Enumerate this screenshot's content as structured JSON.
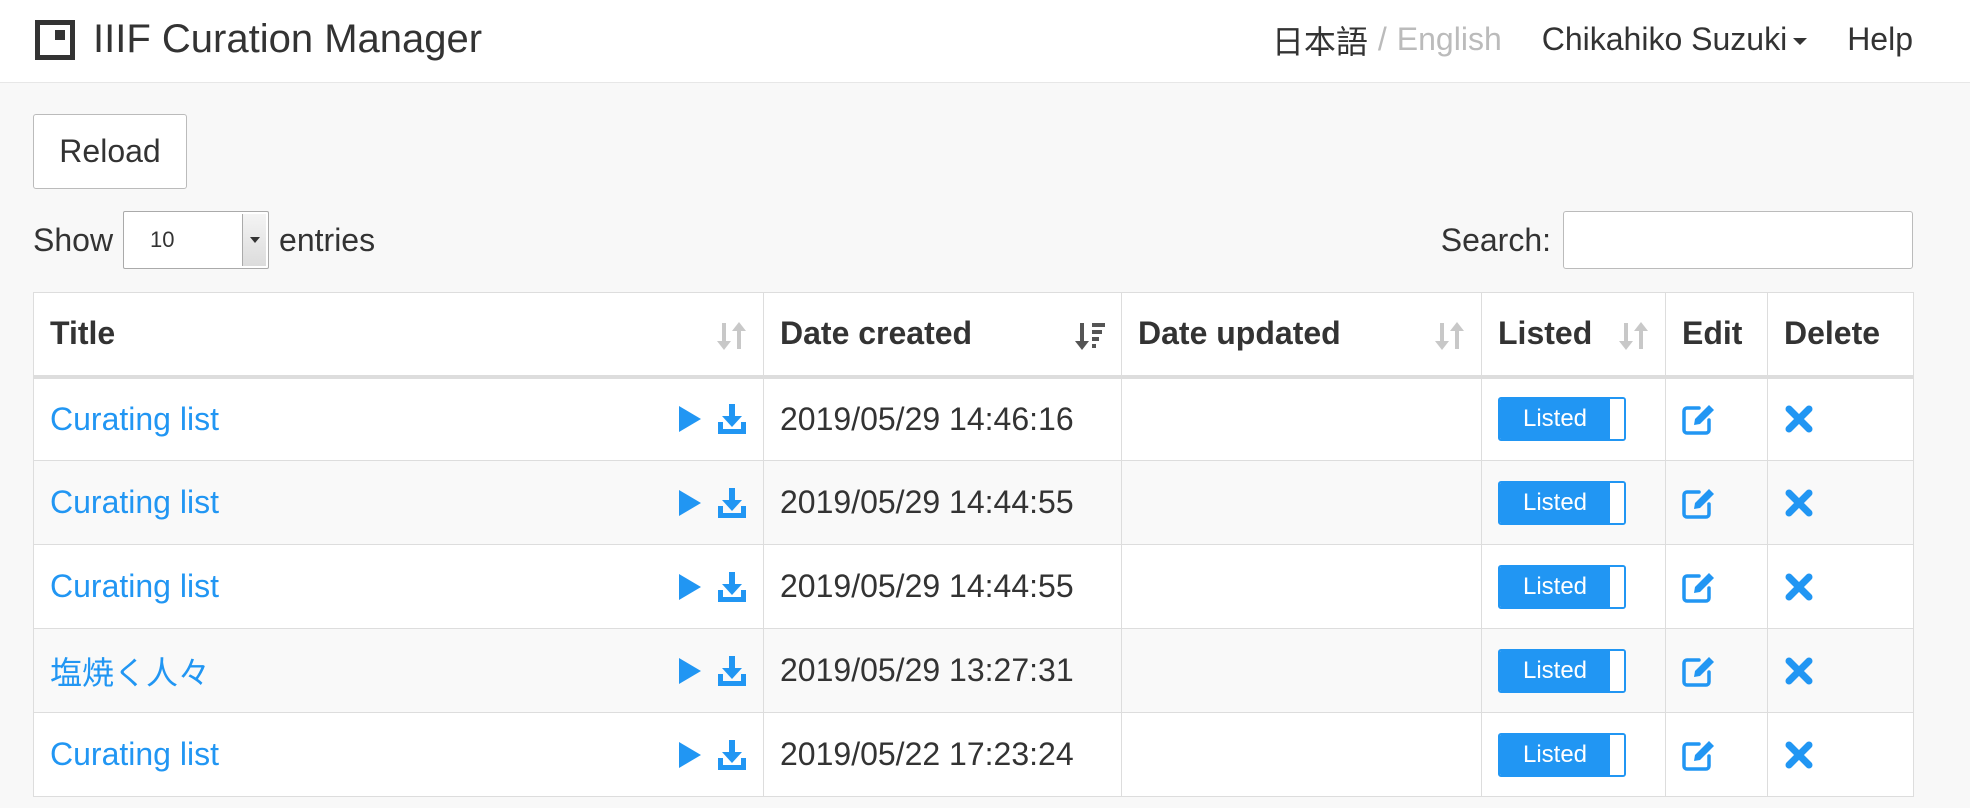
{
  "app": {
    "title": "IIIF Curation Manager",
    "lang_ja": "日本語",
    "lang_separator": "/",
    "lang_en": "English",
    "user_name": "Chikahiko Suzuki",
    "help_label": "Help"
  },
  "toolbar": {
    "reload_label": "Reload",
    "show_label": "Show",
    "entries_label": "entries",
    "entries_value": "10",
    "search_label": "Search:",
    "search_value": ""
  },
  "table": {
    "columns": {
      "title": "Title",
      "date_created": "Date created",
      "date_updated": "Date updated",
      "listed": "Listed",
      "edit": "Edit",
      "delete": "Delete"
    },
    "rows": [
      {
        "title": "Curating list",
        "date_created": "2019/05/29 14:46:16",
        "date_updated": "",
        "listed": "Listed"
      },
      {
        "title": "Curating list",
        "date_created": "2019/05/29 14:44:55",
        "date_updated": "",
        "listed": "Listed"
      },
      {
        "title": "Curating list",
        "date_created": "2019/05/29 14:44:55",
        "date_updated": "",
        "listed": "Listed"
      },
      {
        "title": "塩焼く人々",
        "date_created": "2019/05/29 13:27:31",
        "date_updated": "",
        "listed": "Listed"
      },
      {
        "title": "Curating list",
        "date_created": "2019/05/22 17:23:24",
        "date_updated": "",
        "listed": "Listed"
      }
    ]
  },
  "icons": {
    "brand": "square-frame-icon",
    "play": "play-icon",
    "download": "download-icon",
    "edit": "edit-icon",
    "delete": "close-icon",
    "sort": "sort-icon",
    "sort_desc": "sort-amount-desc-icon"
  },
  "colors": {
    "accent": "#2196f3",
    "text": "#333333",
    "muted": "#bbbbbb",
    "background": "#f8f8f8"
  }
}
